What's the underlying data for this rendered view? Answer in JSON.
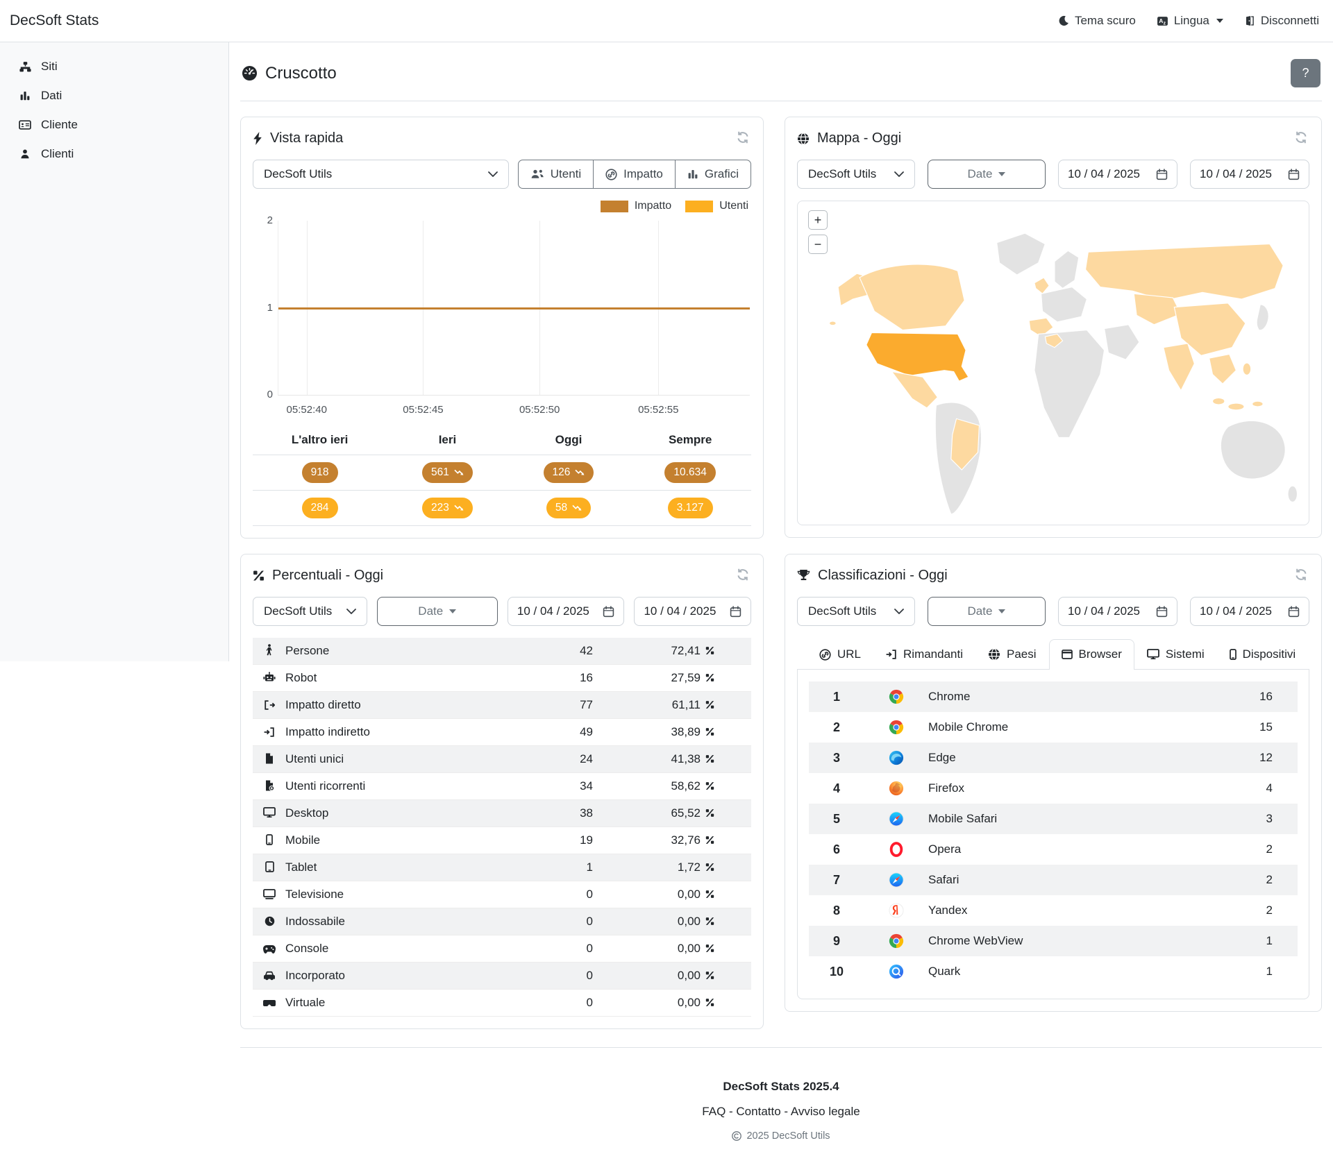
{
  "app": {
    "brand": "DecSoft Stats"
  },
  "navbar": {
    "theme": "Tema scuro",
    "language": "Lingua",
    "logout": "Disconnetti"
  },
  "sidebar": {
    "items": [
      {
        "label": "Siti",
        "icon": "sitemap"
      },
      {
        "label": "Dati",
        "icon": "bars"
      },
      {
        "label": "Cliente",
        "icon": "idcard"
      },
      {
        "label": "Clienti",
        "icon": "user"
      }
    ]
  },
  "page": {
    "title": "Cruscotto",
    "help": "?"
  },
  "quickview": {
    "title": "Vista rapida",
    "site_select": "DecSoft Utils",
    "view_buttons": [
      {
        "label": "Utenti",
        "icon": "users"
      },
      {
        "label": "Impatto",
        "icon": "link"
      },
      {
        "label": "Grafici",
        "icon": "bars"
      }
    ],
    "chart_data": {
      "type": "line",
      "x_ticks": [
        "05:52:40",
        "05:52:45",
        "05:52:50",
        "05:52:55"
      ],
      "y_ticks": [
        "0",
        "1",
        "2"
      ],
      "ylim": [
        0,
        2
      ],
      "grid": true,
      "legend_position": "top-right",
      "series": [
        {
          "name": "Impatto",
          "color": "#c4802f",
          "values": [
            1,
            1,
            1,
            1
          ]
        },
        {
          "name": "Utenti",
          "color": "#fcaf20",
          "values": []
        }
      ]
    },
    "summary": {
      "headers": [
        "L'altro ieri",
        "Ieri",
        "Oggi",
        "Sempre"
      ],
      "rows": [
        {
          "series": "Impatto",
          "color": "#c4802f",
          "cells": [
            {
              "text": "918",
              "trend": false
            },
            {
              "text": "561",
              "trend": true
            },
            {
              "text": "126",
              "trend": true
            },
            {
              "text": "10.634",
              "trend": false
            }
          ]
        },
        {
          "series": "Utenti",
          "color": "#fcaf20",
          "cells": [
            {
              "text": "284",
              "trend": false
            },
            {
              "text": "223",
              "trend": true
            },
            {
              "text": "58",
              "trend": true
            },
            {
              "text": "3.127",
              "trend": false
            }
          ]
        }
      ]
    }
  },
  "map": {
    "title": "Mappa - Oggi",
    "site_select": "DecSoft Utils",
    "date_dropdown": "Date",
    "date_from": "10 / 04 / 2025",
    "date_to": "10 / 04 / 2025",
    "zoom_in": "+",
    "zoom_out": "−",
    "colors": {
      "land": "#e3e3e3",
      "highlight": "#fdd9a0",
      "strong": "#fbab2e",
      "water": "#ffffff"
    }
  },
  "percentages": {
    "title": "Percentuali - Oggi",
    "site_select": "DecSoft Utils",
    "date_dropdown": "Date",
    "date_from": "10 / 04 / 2025",
    "date_to": "10 / 04 / 2025",
    "rows": [
      {
        "icon": "person",
        "label": "Persone",
        "value": "42",
        "pct": "72,41"
      },
      {
        "icon": "robot",
        "label": "Robot",
        "value": "16",
        "pct": "27,59"
      },
      {
        "icon": "signout",
        "label": "Impatto diretto",
        "value": "77",
        "pct": "61,11"
      },
      {
        "icon": "signin",
        "label": "Impatto indiretto",
        "value": "49",
        "pct": "38,89"
      },
      {
        "icon": "file",
        "label": "Utenti unici",
        "value": "24",
        "pct": "41,38"
      },
      {
        "icon": "fileplus",
        "label": "Utenti ricorrenti",
        "value": "34",
        "pct": "58,62"
      },
      {
        "icon": "desktop",
        "label": "Desktop",
        "value": "38",
        "pct": "65,52"
      },
      {
        "icon": "mobile",
        "label": "Mobile",
        "value": "19",
        "pct": "32,76"
      },
      {
        "icon": "tablet",
        "label": "Tablet",
        "value": "1",
        "pct": "1,72"
      },
      {
        "icon": "tv",
        "label": "Televisione",
        "value": "0",
        "pct": "0,00"
      },
      {
        "icon": "watch",
        "label": "Indossabile",
        "value": "0",
        "pct": "0,00"
      },
      {
        "icon": "gamepad",
        "label": "Console",
        "value": "0",
        "pct": "0,00"
      },
      {
        "icon": "car",
        "label": "Incorporato",
        "value": "0",
        "pct": "0,00"
      },
      {
        "icon": "vr",
        "label": "Virtuale",
        "value": "0",
        "pct": "0,00"
      }
    ]
  },
  "rankings": {
    "title": "Classificazioni - Oggi",
    "site_select": "DecSoft Utils",
    "date_dropdown": "Date",
    "date_from": "10 / 04 / 2025",
    "date_to": "10 / 04 / 2025",
    "tabs": [
      {
        "label": "URL",
        "icon": "link",
        "active": false
      },
      {
        "label": "Rimandanti",
        "icon": "signin",
        "active": false
      },
      {
        "label": "Paesi",
        "icon": "globe",
        "active": false
      },
      {
        "label": "Browser",
        "icon": "window",
        "active": true
      },
      {
        "label": "Sistemi",
        "icon": "desktop",
        "active": false
      },
      {
        "label": "Dispositivi",
        "icon": "mobile",
        "active": false
      }
    ],
    "rows": [
      {
        "rank": "1",
        "icon": "chrome",
        "label": "Chrome",
        "value": "16"
      },
      {
        "rank": "2",
        "icon": "chrome",
        "label": "Mobile Chrome",
        "value": "15"
      },
      {
        "rank": "3",
        "icon": "edge",
        "label": "Edge",
        "value": "12"
      },
      {
        "rank": "4",
        "icon": "firefox",
        "label": "Firefox",
        "value": "4"
      },
      {
        "rank": "5",
        "icon": "safari",
        "label": "Mobile Safari",
        "value": "3"
      },
      {
        "rank": "6",
        "icon": "opera",
        "label": "Opera",
        "value": "2"
      },
      {
        "rank": "7",
        "icon": "safari",
        "label": "Safari",
        "value": "2"
      },
      {
        "rank": "8",
        "icon": "yandex",
        "label": "Yandex",
        "value": "2"
      },
      {
        "rank": "9",
        "icon": "chrome",
        "label": "Chrome WebView",
        "value": "1"
      },
      {
        "rank": "10",
        "icon": "quark",
        "label": "Quark",
        "value": "1"
      }
    ]
  },
  "footer": {
    "version": "DecSoft Stats 2025.4",
    "links": [
      "FAQ",
      "Contatto",
      "Avviso legale"
    ],
    "copyright": "2025 DecSoft Utils"
  }
}
